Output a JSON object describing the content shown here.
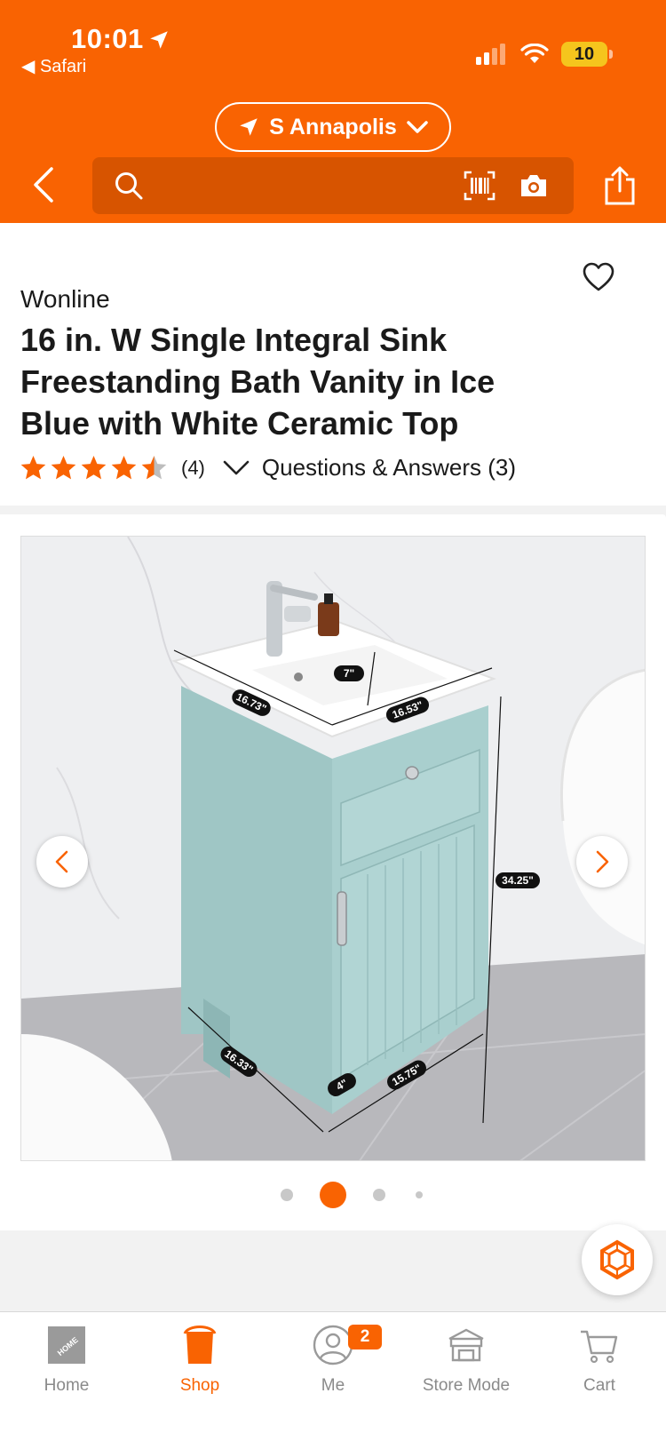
{
  "status_bar": {
    "time": "10:01",
    "back_app": "Safari",
    "battery": "10"
  },
  "header": {
    "store": "S Annapolis"
  },
  "product": {
    "brand": "Wonline",
    "title": "16 in. W Single Integral Sink Freestanding Bath Vanity in Ice Blue with White Ceramic Top",
    "rating": 4.5,
    "review_count": "(4)",
    "qa_label": "Questions & Answers (3)"
  },
  "photo": {
    "dimensions": {
      "depth_top": "16.73\"",
      "width_top": "16.53\"",
      "basin_depth": "7\"",
      "height": "34.25\"",
      "depth_bottom": "16.33\"",
      "width_bottom": "15.75\"",
      "leg": "4\""
    }
  },
  "gallery": {
    "current_index": 2,
    "count": 4
  },
  "tabbar": {
    "tabs": [
      {
        "label": "Home",
        "icon": "home-depot-logo-icon"
      },
      {
        "label": "Shop",
        "icon": "bucket-icon"
      },
      {
        "label": "Me",
        "icon": "person-icon"
      },
      {
        "label": "Store Mode",
        "icon": "store-icon"
      },
      {
        "label": "Cart",
        "icon": "cart-icon"
      }
    ],
    "me_badge": "2"
  },
  "colors": {
    "brand": "#f96302",
    "search_bg": "#d75400",
    "vanity": "#a9cfce"
  }
}
